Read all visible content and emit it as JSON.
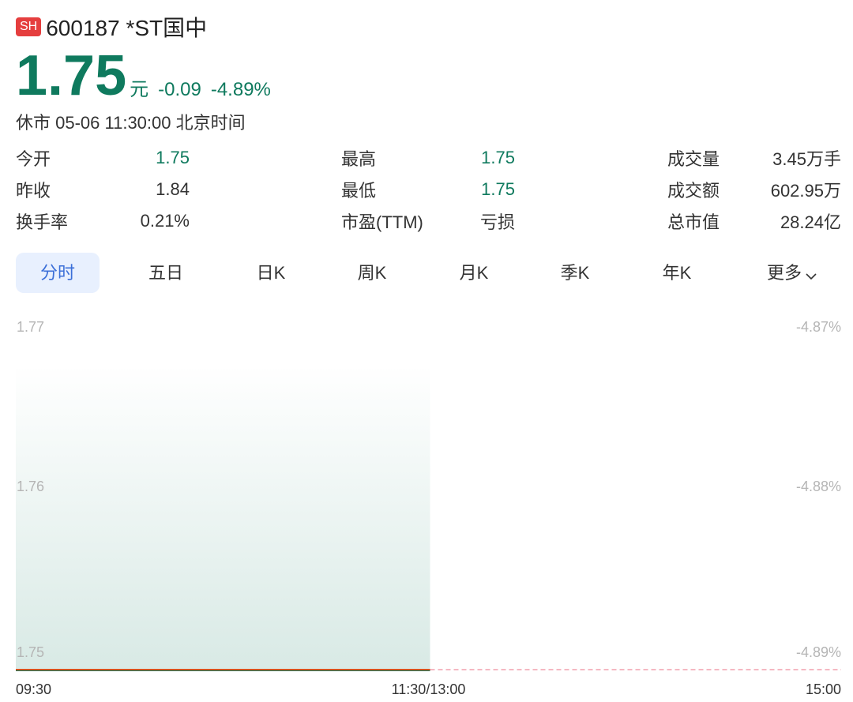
{
  "header": {
    "exchange_badge": "SH",
    "title": "600187 *ST国中"
  },
  "quote": {
    "price": "1.75",
    "unit": "元",
    "change": "-0.09",
    "change_pct": "-4.89%",
    "status": "休市 05-06 11:30:00 北京时间",
    "color": "#0f7a5e"
  },
  "stats": [
    [
      {
        "label": "今开",
        "value": "1.75",
        "highlight": true
      },
      {
        "label": "最高",
        "value": "1.75",
        "highlight": true
      },
      {
        "label": "成交量",
        "value": "3.45万手",
        "highlight": false
      }
    ],
    [
      {
        "label": "昨收",
        "value": "1.84",
        "highlight": false
      },
      {
        "label": "最低",
        "value": "1.75",
        "highlight": true
      },
      {
        "label": "成交额",
        "value": "602.95万",
        "highlight": false
      }
    ],
    [
      {
        "label": "换手率",
        "value": "0.21%",
        "highlight": false
      },
      {
        "label": "市盈(TTM)",
        "value": "亏损",
        "highlight": false
      },
      {
        "label": "总市值",
        "value": "28.24亿",
        "highlight": false
      }
    ]
  ],
  "tabs": [
    {
      "label": "分时",
      "active": true
    },
    {
      "label": "五日",
      "active": false
    },
    {
      "label": "日K",
      "active": false
    },
    {
      "label": "周K",
      "active": false
    },
    {
      "label": "月K",
      "active": false
    },
    {
      "label": "季K",
      "active": false
    },
    {
      "label": "年K",
      "active": false
    },
    {
      "label": "更多",
      "active": false
    }
  ],
  "chart_data": {
    "type": "line",
    "y_ticks_left": [
      "1.77",
      "1.76",
      "1.75"
    ],
    "y_ticks_right": [
      "-4.87%",
      "-4.88%",
      "-4.89%"
    ],
    "x_ticks": [
      "09:30",
      "11:30/13:00",
      "15:00"
    ],
    "ylim": [
      1.75,
      1.77
    ],
    "prev_close": 1.84,
    "series": [
      {
        "x": [
          "09:30",
          "11:30"
        ],
        "values": [
          1.75,
          1.75
        ]
      }
    ],
    "session_progress": 0.5,
    "colors": {
      "price_line": "#d9531e",
      "area_fill": "#0f7a5e",
      "baseline_dash": "#f2a0ad"
    }
  }
}
